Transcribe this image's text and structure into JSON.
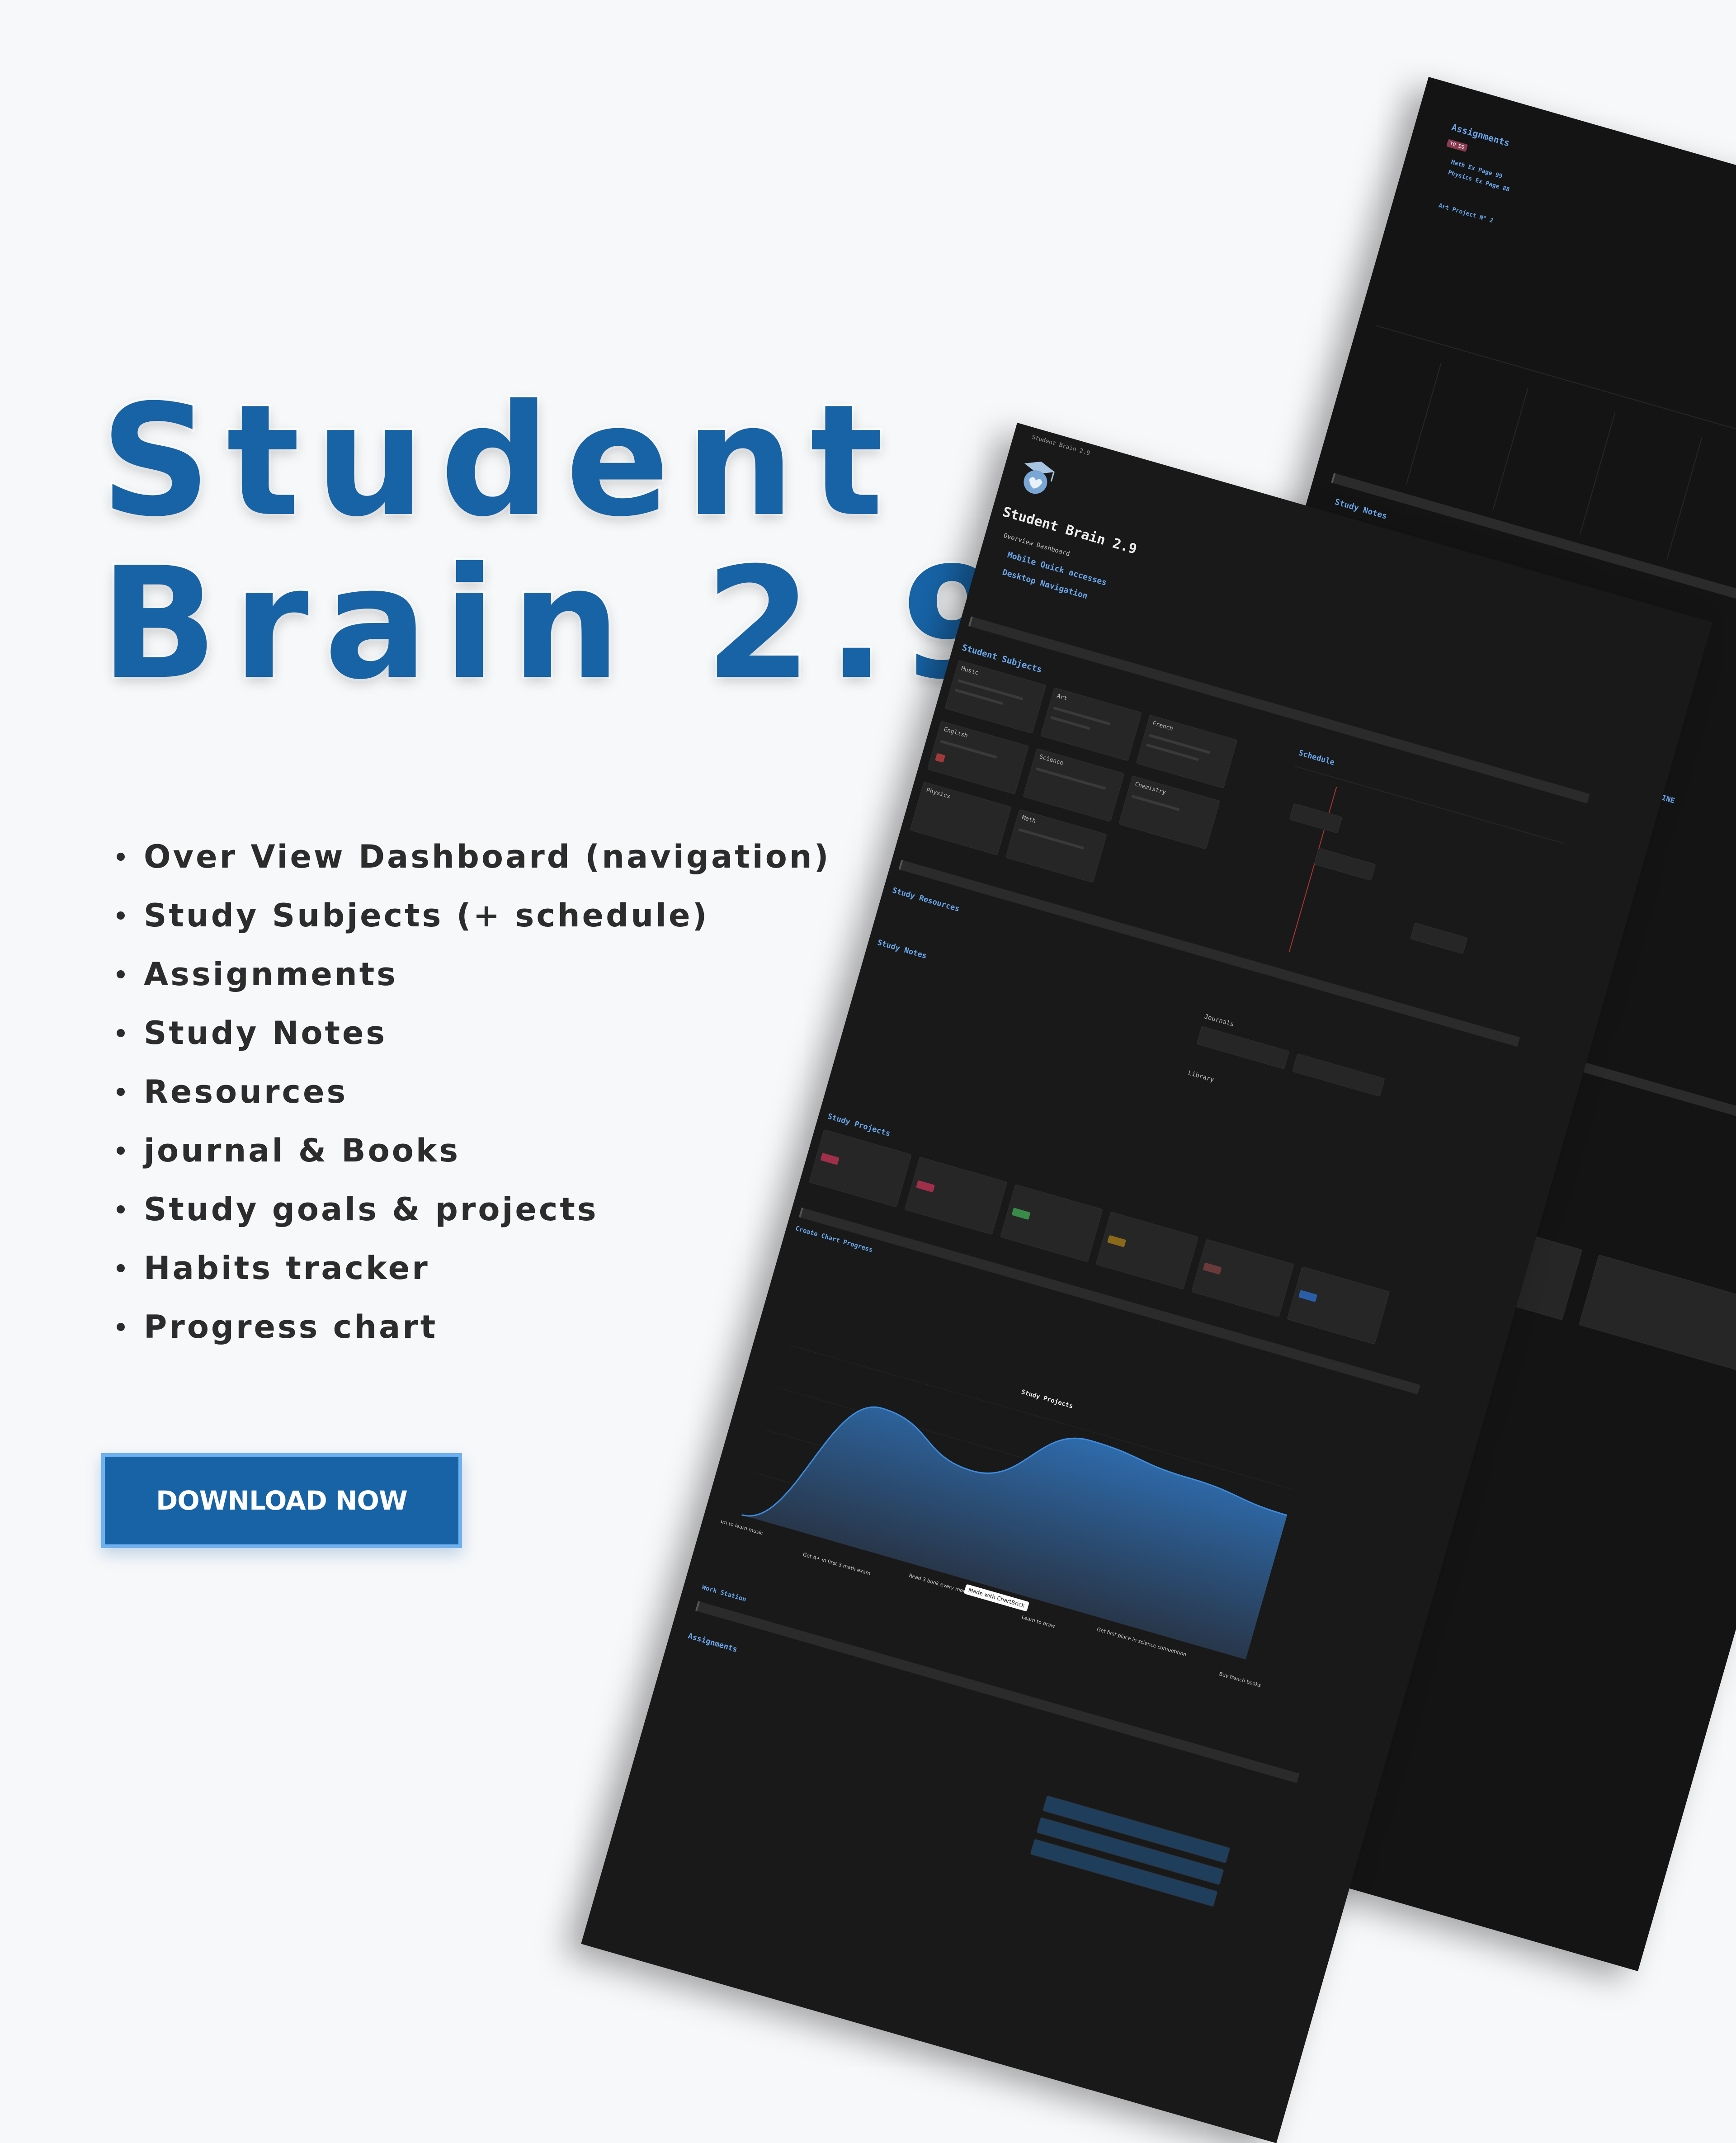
{
  "hero": {
    "title_line1": "Student",
    "title_line2": "Brain 2.9"
  },
  "features": [
    "Over View Dashboard (navigation)",
    "Study Subjects (+ schedule)",
    "Assignments",
    "Study Notes",
    "Resources",
    "journal & Books",
    "Study goals & projects",
    "Habits tracker",
    "Progress chart"
  ],
  "cta": {
    "label": "DOWNLOAD NOW"
  },
  "colors": {
    "brand_blue": "#1763a6",
    "button_border": "#6fb0ee",
    "panel_bg": "#191919",
    "accent_blue": "#6aa7ec"
  },
  "mockup_front": {
    "window_title": "Student Brain 2.9",
    "page_title": "Student Brain 2.9",
    "sections": {
      "overview": "Overview Dashboard",
      "mobile": "Mobile Quick accesses",
      "desktop": "Desktop Navigation",
      "subjects_heading": "Student Subjects",
      "schedule": "Schedule",
      "resources": "Study Resources",
      "notes": "Study Notes",
      "journals": "Journals",
      "library": "Library",
      "projects": "Study Projects",
      "progress": "Create Chart Progress",
      "chart_title": "Study Projects",
      "work_station": "Work Station",
      "assignments": "Assignments",
      "made_with": "Made with ChartBrick"
    },
    "subjects": [
      "Music",
      "Art",
      "French",
      "English",
      "Science",
      "Chemistry",
      "Physics",
      "Math"
    ]
  },
  "mockup_back": {
    "assignments": "Assignments",
    "to_do": "TO DO",
    "items": [
      "Math Ex Page 99",
      "Physics Ex Page 88",
      "Art Project N° 2"
    ],
    "study_notes": "Study Notes",
    "student_routine": "Student ROUTINE"
  },
  "chart_data": {
    "type": "area",
    "title": "Study Projects",
    "x": [
      "Learn to learn music",
      "Get A+ in first 3 math exam",
      "Read 3 book every month",
      "Learn to draw",
      "Get first place in science competition",
      "Buy french books"
    ],
    "values": [
      0,
      80,
      60,
      95,
      90,
      85
    ]
  }
}
